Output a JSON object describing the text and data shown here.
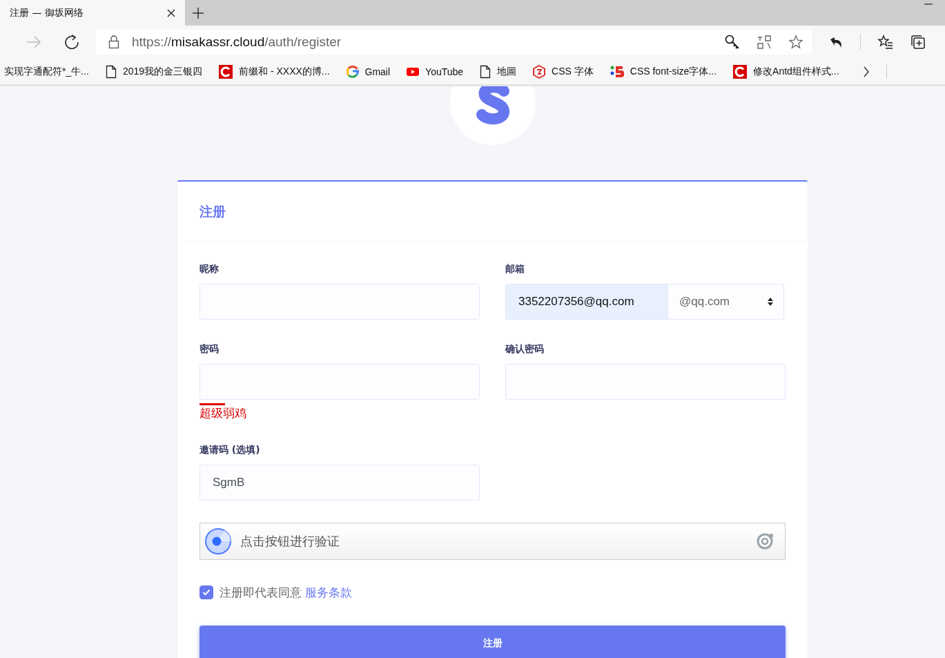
{
  "browser": {
    "tab": {
      "title": "注册 — 御坂网络",
      "selected": true
    },
    "address": {
      "scheme": "https://",
      "host": "misakassr.cloud",
      "path": "/auth/register"
    },
    "bookmarks": [
      {
        "kind": "none",
        "label": "实现字通配符*_牛..."
      },
      {
        "kind": "page",
        "label": "2019我的金三银四"
      },
      {
        "kind": "csdn",
        "label": "前缀和 - XXXX的博..."
      },
      {
        "kind": "google",
        "label": "Gmail"
      },
      {
        "kind": "youtube",
        "label": "YouTube"
      },
      {
        "kind": "page",
        "label": "地圖"
      },
      {
        "kind": "hexagon",
        "label": "CSS 字体"
      },
      {
        "kind": "five",
        "label": "CSS font-size字体..."
      },
      {
        "kind": "csdn",
        "label": "修改Antd组件样式..."
      }
    ]
  },
  "form": {
    "title": "注册",
    "fields": [
      {
        "kind": "text",
        "label": "昵称"
      },
      {
        "kind": "email",
        "label": "邮箱",
        "value": "3352207356@qq.com",
        "autofilled": true,
        "suffix": "@qq.com"
      },
      {
        "kind": "password",
        "label": "密码",
        "strength": {
          "text": "超级弱鸡",
          "level": 0.09
        }
      },
      {
        "kind": "password",
        "label": "确认密码"
      },
      {
        "kind": "text",
        "label": "邀请码 (选填)",
        "value": "SgmB"
      }
    ],
    "captcha": {
      "text": "点击按钮进行验证"
    },
    "agreement": {
      "checked": true,
      "text": "注册即代表同意",
      "link": "服务条款"
    },
    "submit": "注册"
  }
}
